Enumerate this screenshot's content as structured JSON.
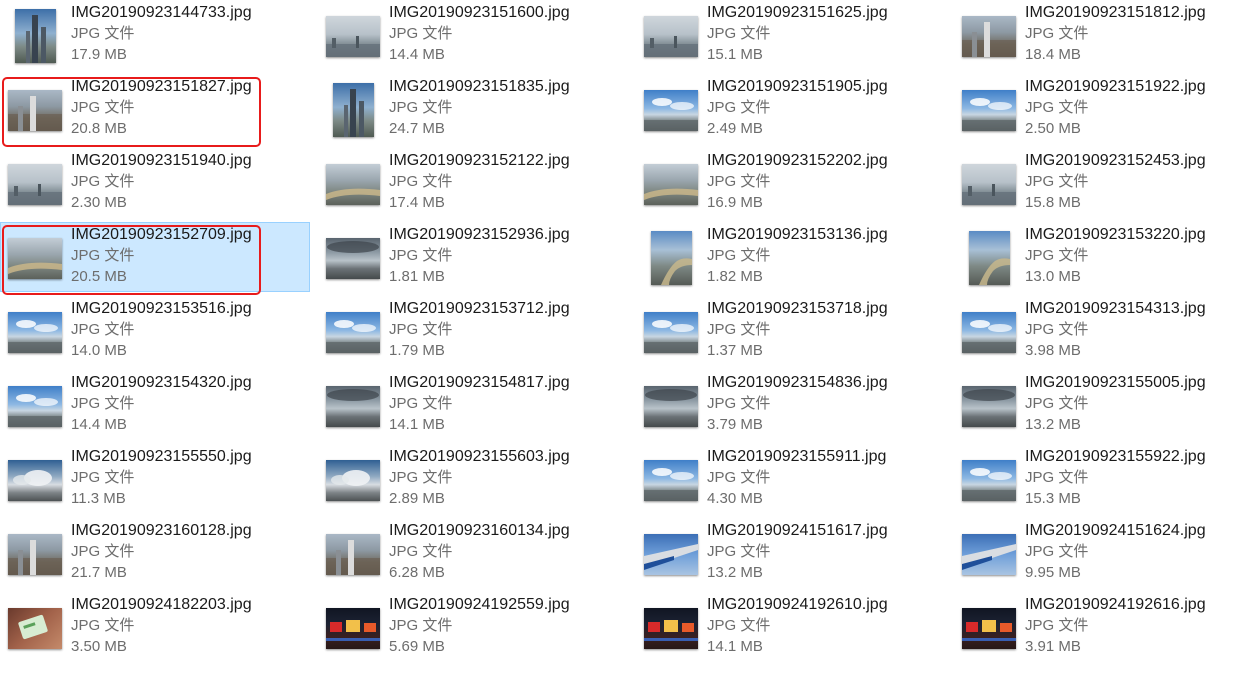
{
  "colors": {
    "selection_bg": "#cce8ff",
    "selection_border": "#99d1ff",
    "annotation_red": "#e81b1b"
  },
  "files": [
    {
      "name": "IMG20190923144733.jpg",
      "type": "JPG 文件",
      "size": "17.9 MB",
      "thumb": "tower-portrait"
    },
    {
      "name": "IMG20190923151600.jpg",
      "type": "JPG 文件",
      "size": "14.4 MB",
      "thumb": "city-haze"
    },
    {
      "name": "IMG20190923151625.jpg",
      "type": "JPG 文件",
      "size": "15.1 MB",
      "thumb": "city-haze"
    },
    {
      "name": "IMG20190923151812.jpg",
      "type": "JPG 文件",
      "size": "18.4 MB",
      "thumb": "city-aerial"
    },
    {
      "name": "IMG20190923151827.jpg",
      "type": "JPG 文件",
      "size": "20.8 MB",
      "thumb": "city-aerial"
    },
    {
      "name": "IMG20190923151835.jpg",
      "type": "JPG 文件",
      "size": "24.7 MB",
      "thumb": "tower-portrait"
    },
    {
      "name": "IMG20190923151905.jpg",
      "type": "JPG 文件",
      "size": "2.49 MB",
      "thumb": "sky-city"
    },
    {
      "name": "IMG20190923151922.jpg",
      "type": "JPG 文件",
      "size": "2.50 MB",
      "thumb": "sky-city"
    },
    {
      "name": "IMG20190923151940.jpg",
      "type": "JPG 文件",
      "size": "2.30 MB",
      "thumb": "city-haze"
    },
    {
      "name": "IMG20190923152122.jpg",
      "type": "JPG 文件",
      "size": "17.4 MB",
      "thumb": "river-city"
    },
    {
      "name": "IMG20190923152202.jpg",
      "type": "JPG 文件",
      "size": "16.9 MB",
      "thumb": "river-city"
    },
    {
      "name": "IMG20190923152453.jpg",
      "type": "JPG 文件",
      "size": "15.8 MB",
      "thumb": "city-haze"
    },
    {
      "name": "IMG20190923152709.jpg",
      "type": "JPG 文件",
      "size": "20.5 MB",
      "thumb": "river-city"
    },
    {
      "name": "IMG20190923152936.jpg",
      "type": "JPG 文件",
      "size": "1.81 MB",
      "thumb": "cloud-dark"
    },
    {
      "name": "IMG20190923153136.jpg",
      "type": "JPG 文件",
      "size": "1.82 MB",
      "thumb": "river-portrait"
    },
    {
      "name": "IMG20190923153220.jpg",
      "type": "JPG 文件",
      "size": "13.0 MB",
      "thumb": "river-portrait"
    },
    {
      "name": "IMG20190923153516.jpg",
      "type": "JPG 文件",
      "size": "14.0 MB",
      "thumb": "sky-city"
    },
    {
      "name": "IMG20190923153712.jpg",
      "type": "JPG 文件",
      "size": "1.79 MB",
      "thumb": "sky-city"
    },
    {
      "name": "IMG20190923153718.jpg",
      "type": "JPG 文件",
      "size": "1.37 MB",
      "thumb": "sky-city"
    },
    {
      "name": "IMG20190923154313.jpg",
      "type": "JPG 文件",
      "size": "3.98 MB",
      "thumb": "sky-city"
    },
    {
      "name": "IMG20190923154320.jpg",
      "type": "JPG 文件",
      "size": "14.4 MB",
      "thumb": "sky-city"
    },
    {
      "name": "IMG20190923154817.jpg",
      "type": "JPG 文件",
      "size": "14.1 MB",
      "thumb": "cloud-dark"
    },
    {
      "name": "IMG20190923154836.jpg",
      "type": "JPG 文件",
      "size": "3.79 MB",
      "thumb": "cloud-dark"
    },
    {
      "name": "IMG20190923155005.jpg",
      "type": "JPG 文件",
      "size": "13.2 MB",
      "thumb": "cloud-dark"
    },
    {
      "name": "IMG20190923155550.jpg",
      "type": "JPG 文件",
      "size": "11.3 MB",
      "thumb": "cloud-sky"
    },
    {
      "name": "IMG20190923155603.jpg",
      "type": "JPG 文件",
      "size": "2.89 MB",
      "thumb": "cloud-sky"
    },
    {
      "name": "IMG20190923155911.jpg",
      "type": "JPG 文件",
      "size": "4.30 MB",
      "thumb": "sky-city"
    },
    {
      "name": "IMG20190923155922.jpg",
      "type": "JPG 文件",
      "size": "15.3 MB",
      "thumb": "sky-city"
    },
    {
      "name": "IMG20190923160128.jpg",
      "type": "JPG 文件",
      "size": "21.7 MB",
      "thumb": "city-aerial"
    },
    {
      "name": "IMG20190923160134.jpg",
      "type": "JPG 文件",
      "size": "6.28 MB",
      "thumb": "city-aerial"
    },
    {
      "name": "IMG20190924151617.jpg",
      "type": "JPG 文件",
      "size": "13.2 MB",
      "thumb": "airplane-wing"
    },
    {
      "name": "IMG20190924151624.jpg",
      "type": "JPG 文件",
      "size": "9.95 MB",
      "thumb": "airplane-wing"
    },
    {
      "name": "IMG20190924182203.jpg",
      "type": "JPG 文件",
      "size": "3.50 MB",
      "thumb": "ticket-hand"
    },
    {
      "name": "IMG20190924192559.jpg",
      "type": "JPG 文件",
      "size": "5.69 MB",
      "thumb": "night-street"
    },
    {
      "name": "IMG20190924192610.jpg",
      "type": "JPG 文件",
      "size": "14.1 MB",
      "thumb": "night-street"
    },
    {
      "name": "IMG20190924192616.jpg",
      "type": "JPG 文件",
      "size": "3.91 MB",
      "thumb": "night-street"
    }
  ],
  "selected_index": 12,
  "highlighted_indices": [
    4,
    12
  ]
}
